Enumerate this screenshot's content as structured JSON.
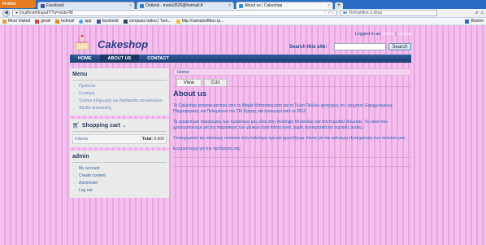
{
  "browser": {
    "firefox_label": "Firefox",
    "tabs": [
      {
        "label": "Facebook",
        "color": "#3b5998"
      },
      {
        "label": "Outlook - maria3520@hotmail.fr",
        "color": "#2e7bd6"
      },
      {
        "label": "About us | Cakeshop",
        "color": "#3b8fd1"
      }
    ],
    "new_tab": "+",
    "url": "localhost/drupal7/?q=node/48",
    "search_value": "Romantina a shop",
    "bookmarks": [
      "Most Visited",
      "gmail",
      "hotmail",
      "app",
      "facebook",
      "compass tattoo | Tum...",
      "http://camalsoftbox.tu..."
    ],
    "bookmarks_right": "Bookm"
  },
  "site": {
    "name": "Cakeshop",
    "logged_in_text": "Logged in as",
    "user": "admin",
    "separator": "|",
    "logout": "Logout",
    "search_label": "Search this site:",
    "search_button": "Search",
    "nav": [
      "HOME",
      "ABOUT US",
      "CONTACT"
    ]
  },
  "sidebar": {
    "menu_title": "Menu",
    "menu_items": [
      "Προϊόντα",
      "Συνταγές",
      "Τρόποι πληρωμής και διαδικασία συναλλαγών",
      "Έξοδα αποστολής"
    ],
    "cart_title": "Shopping cart",
    "cart_toggle": "▲",
    "cart_items": "0 items",
    "cart_total_label": "Total:",
    "cart_total": "0.00€",
    "admin_title": "admin",
    "admin_items": [
      "My account",
      "Create content",
      "Administer",
      "Log out"
    ]
  },
  "main": {
    "breadcrumb": "Home",
    "tab_view": "View",
    "tab_edit": "Edit",
    "title": "About us",
    "paragraphs": [
      "Το Cakeshop κατασκευάστηκε από τη Μαρία Μπατσακούτσα και τη Γιώτα Πούλου φοιτήτριες του τμήματος Εφαρμοσμένης Πληροφορικής και Πολυμέσων του ΤΕΙ Κρήτης και λειτουργεί από το 2012.",
      "Τα εργαστήρια παραγωγής των προϊόντων μας είναι στην Αναλήψη Θεσσαλίας και στο Κορυδαλ Βοιωτίας. Τα υλικά που χρησιμοποιούμε για την παρασκευή των γλυκών είναι πάντα αγνά, χωρίς συντηρητικά και τεχνητές ουσίες.",
      "Υποσχόμαστε την καλύτερη ποιότητα στην καλύτερη τιμή και φροντίζουμε πάντα για την καλύτερη εξυπηρέτηση των πελατών μας.",
      "Ευχαριστούμε για την προτίμηση σας."
    ]
  },
  "colors": {
    "page_bg": "#f3c0ee",
    "nav_bg": "#2f5f9c",
    "title_color": "#1c3f78",
    "text_color": "#1f5fb0"
  }
}
